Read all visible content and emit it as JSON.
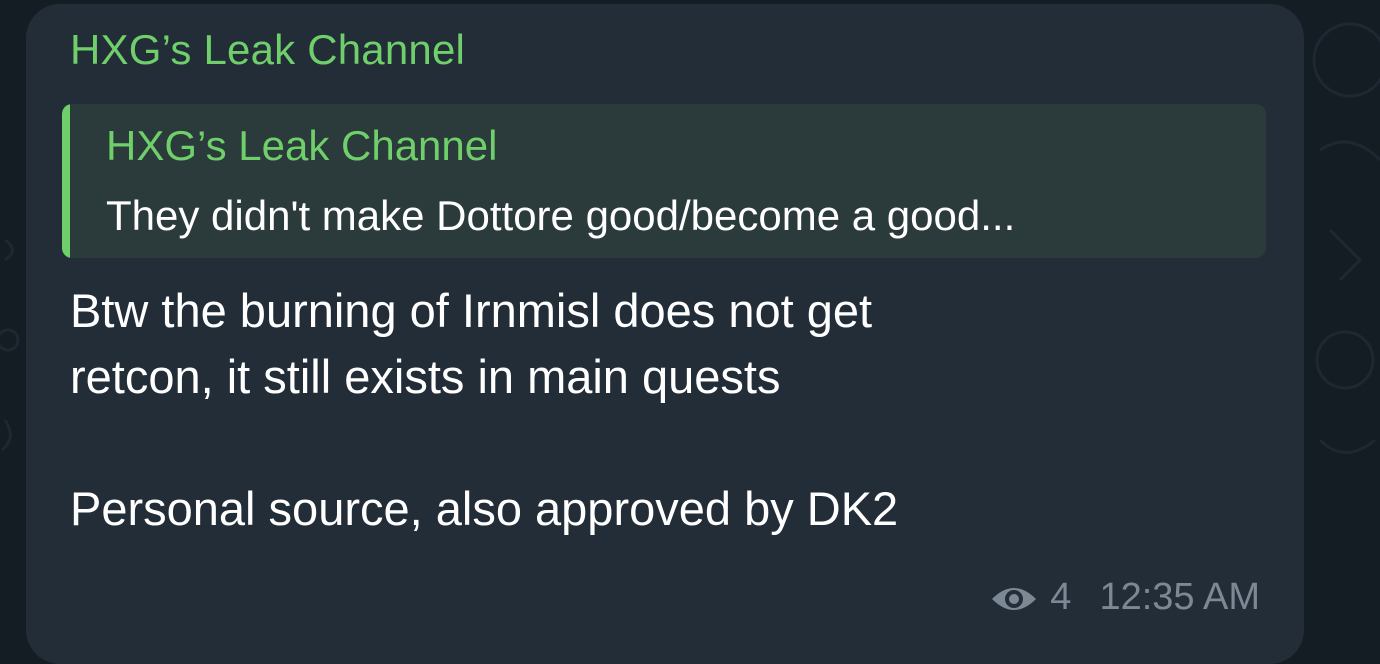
{
  "message": {
    "sender": "HXG’s Leak Channel",
    "reply": {
      "name": "HXG’s Leak Channel",
      "preview": "They didn't make Dottore good/become a good..."
    },
    "text_line1": "Btw the burning of Irnmisl does not get",
    "text_line2": "retcon, it still exists in main quests",
    "text_line3": "Personal source, also approved by DK2",
    "views": "4",
    "time": "12:35 AM"
  },
  "colors": {
    "accent": "#6fcf6a",
    "bubble": "#232d38",
    "background": "#141c24",
    "meta": "#7c8894"
  },
  "icons": {
    "views": "eye-icon"
  }
}
